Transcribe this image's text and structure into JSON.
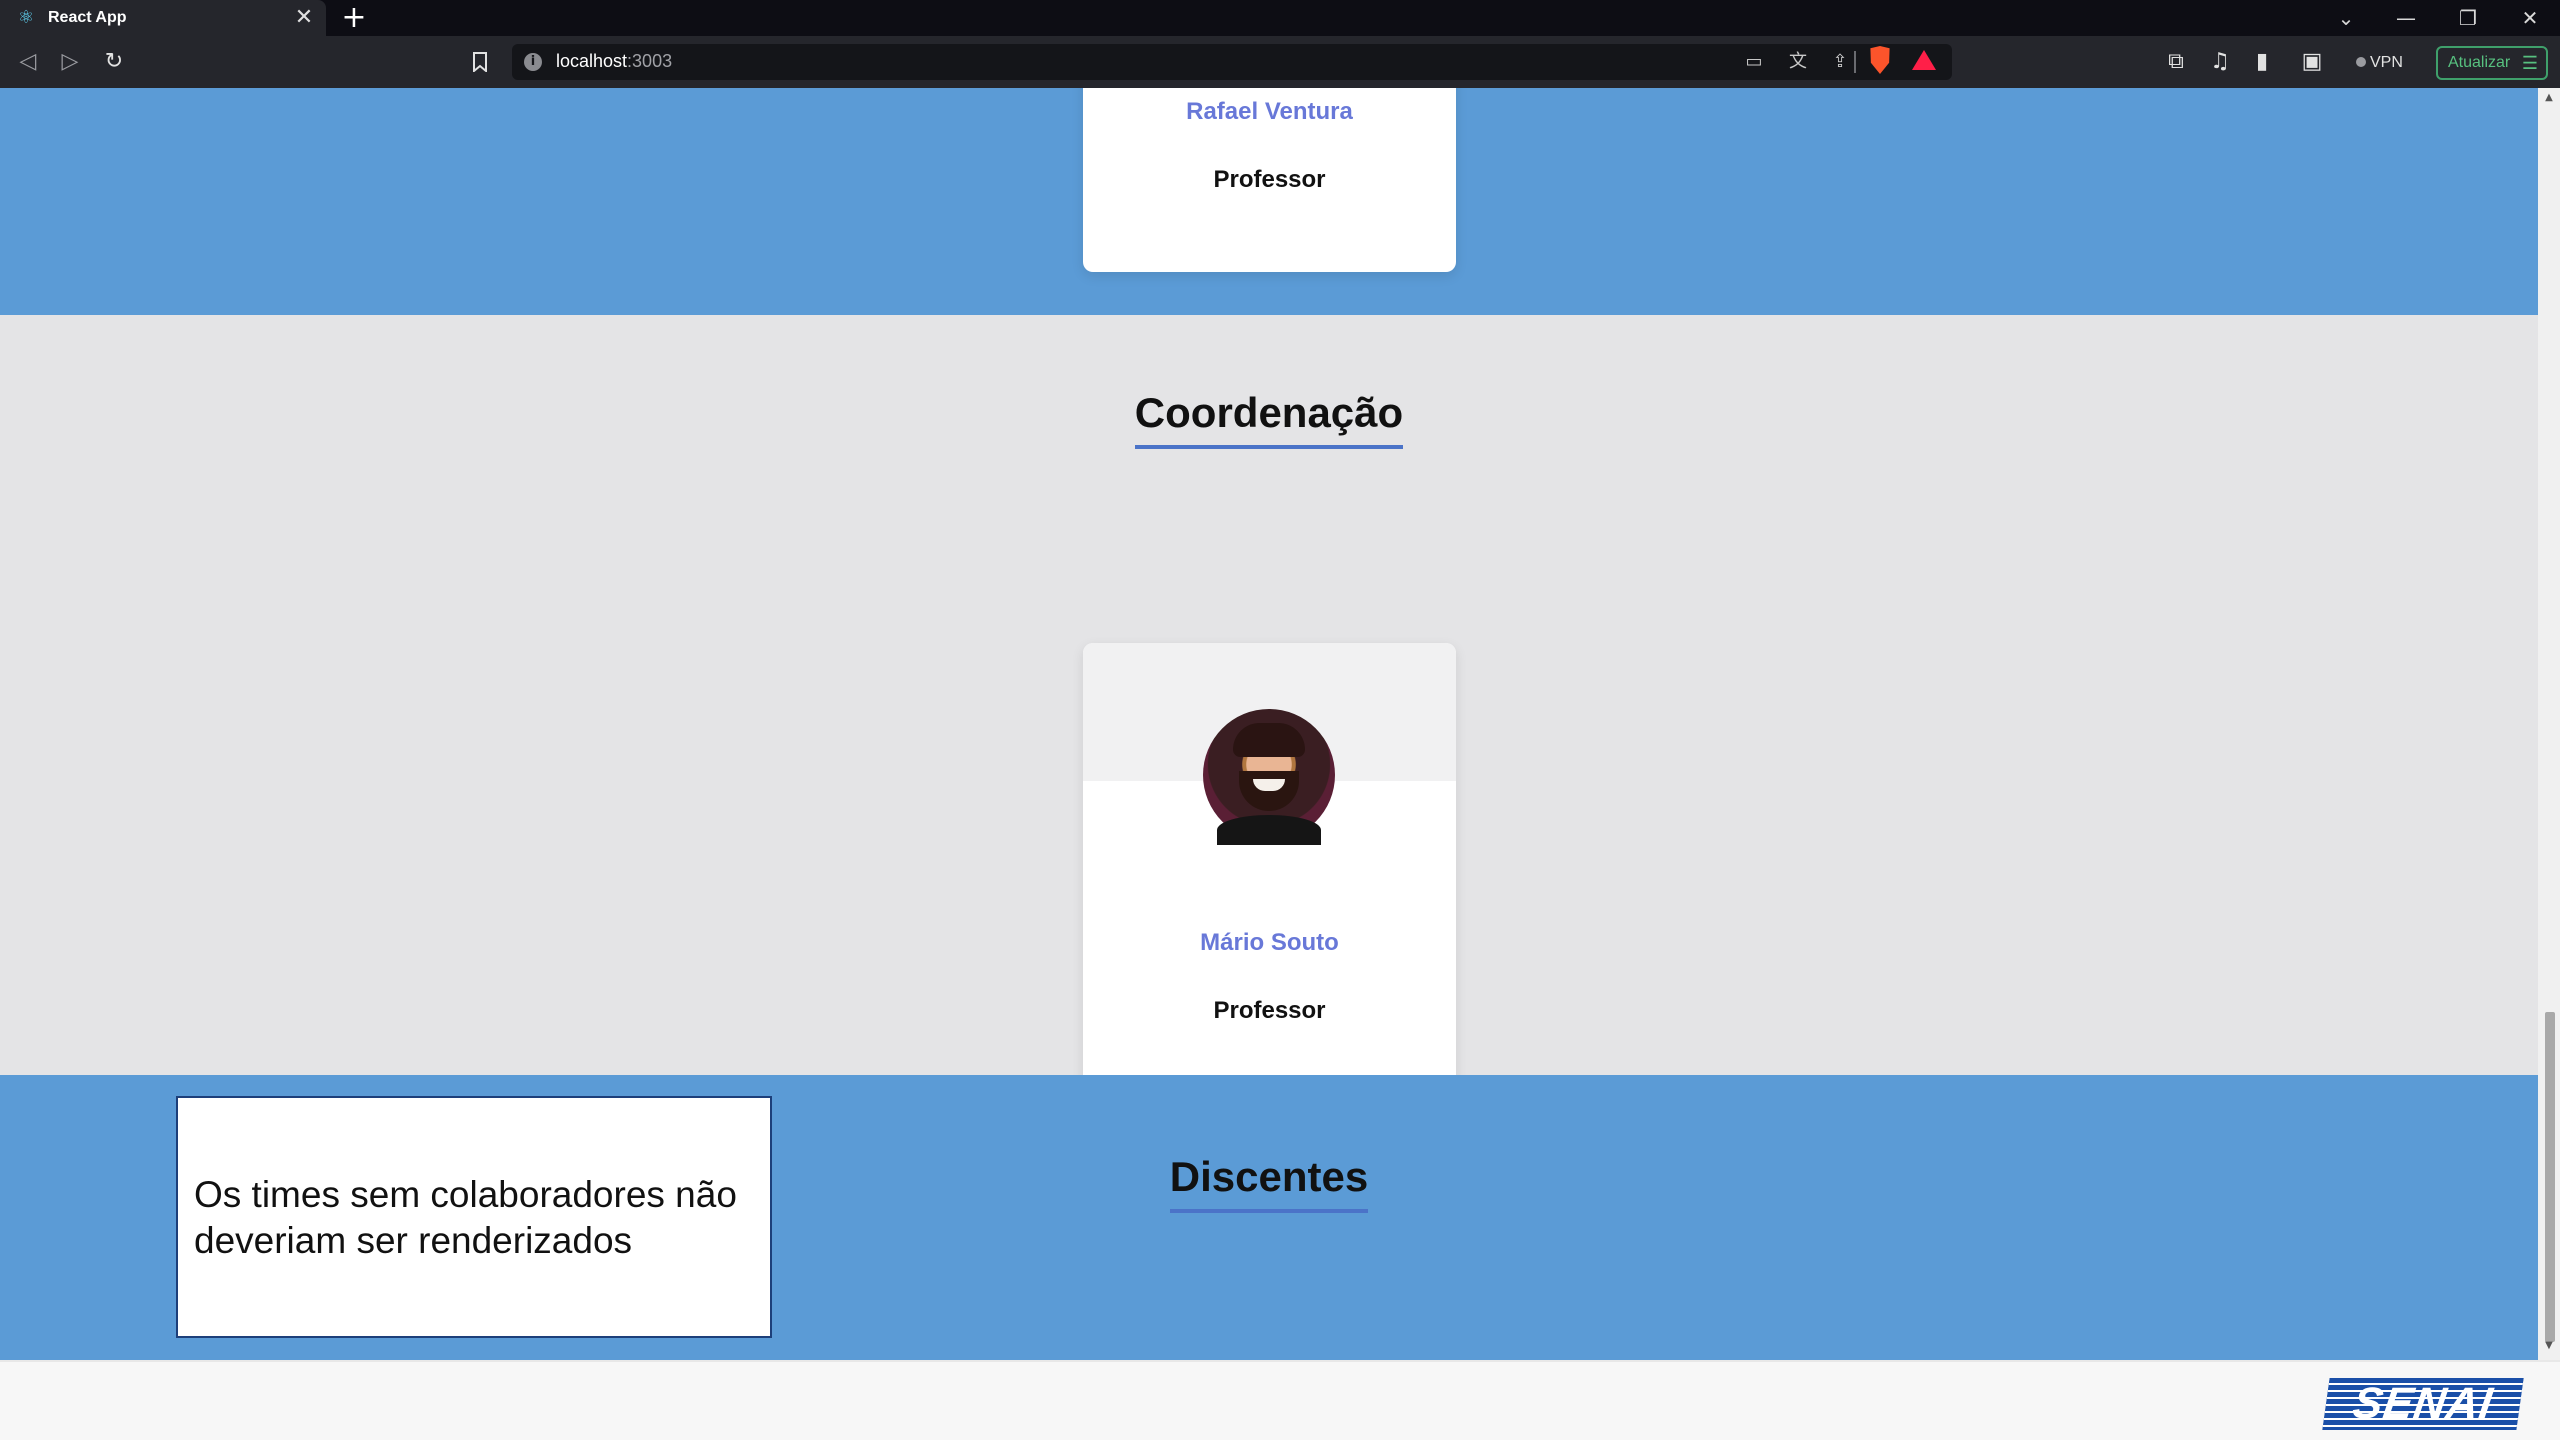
{
  "browser": {
    "tab": {
      "title": "React App",
      "close": "✕"
    },
    "new_tab": "+",
    "window_controls": {
      "tab_search": "⌄",
      "minimize": "—",
      "restore": "❐",
      "close": "✕"
    },
    "nav": {
      "back": "◁",
      "forward": "▷",
      "reload": "↻",
      "bookmark": "🔖"
    },
    "address": {
      "host": "localhost",
      "port": ":3003",
      "info": "i"
    },
    "omnibox_icons": {
      "cast": "▭",
      "translate": "文",
      "share": "⇪"
    },
    "extensions": {
      "puzzle": "⧉",
      "music": "♫",
      "sidebar": "▮",
      "wallet": "▣"
    },
    "vpn_label": "VPN",
    "update_label": "Atualizar",
    "update_menu": "☰"
  },
  "page": {
    "top_card": {
      "name": "Rafael Ventura",
      "role": "Professor"
    },
    "coordenacao": {
      "title": "Coordenação",
      "card": {
        "name": "Mário Souto",
        "role": "Professor"
      }
    },
    "discentes": {
      "title": "Discentes"
    },
    "annotation": "Os times sem colaboradores não deveriam ser renderizados",
    "footer_logo": "SENAI"
  },
  "colors": {
    "section_blue": "#5b9bd6",
    "section_grey": "#e4e4e6",
    "name_accent": "#6878d8",
    "title_underline": "#4b73c8",
    "browser_dark": "#25262c"
  }
}
